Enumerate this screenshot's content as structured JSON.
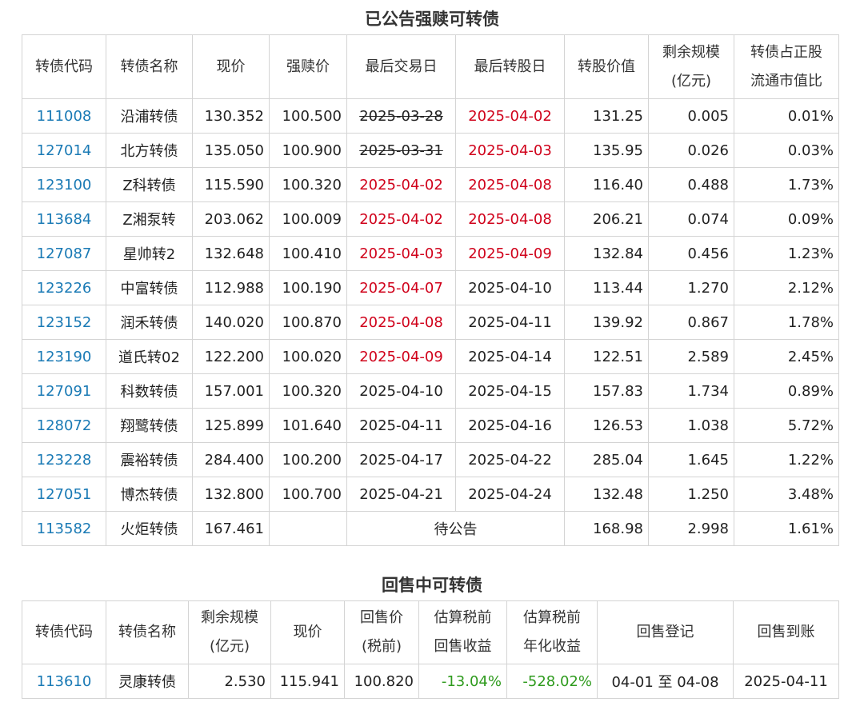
{
  "table1": {
    "title": "已公告强赎可转债",
    "headers": [
      "转债代码",
      "转债名称",
      "现价",
      "强赎价",
      "最后交易日",
      "最后转股日",
      "转股价值",
      "剩余规模\n(亿元)",
      "转债占正股\n流通市值比"
    ],
    "pending_label": "待公告",
    "rows": [
      {
        "code": "111008",
        "name": "沿浦转债",
        "price": "130.352",
        "redeem": "100.500",
        "last_trade": "2025-03-28",
        "last_trade_style": "strike",
        "last_conv": "2025-04-02",
        "last_conv_style": "red",
        "conv_value": "131.25",
        "remain": "0.005",
        "ratio": "0.01%"
      },
      {
        "code": "127014",
        "name": "北方转债",
        "price": "135.050",
        "redeem": "100.900",
        "last_trade": "2025-03-31",
        "last_trade_style": "strike",
        "last_conv": "2025-04-03",
        "last_conv_style": "red",
        "conv_value": "135.95",
        "remain": "0.026",
        "ratio": "0.03%"
      },
      {
        "code": "123100",
        "name": "Z科转债",
        "price": "115.590",
        "redeem": "100.320",
        "last_trade": "2025-04-02",
        "last_trade_style": "red",
        "last_conv": "2025-04-08",
        "last_conv_style": "red",
        "conv_value": "116.40",
        "remain": "0.488",
        "ratio": "1.73%"
      },
      {
        "code": "113684",
        "name": "Z湘泵转",
        "price": "203.062",
        "redeem": "100.009",
        "last_trade": "2025-04-02",
        "last_trade_style": "red",
        "last_conv": "2025-04-08",
        "last_conv_style": "red",
        "conv_value": "206.21",
        "remain": "0.074",
        "ratio": "0.09%"
      },
      {
        "code": "127087",
        "name": "星帅转2",
        "price": "132.648",
        "redeem": "100.410",
        "last_trade": "2025-04-03",
        "last_trade_style": "red",
        "last_conv": "2025-04-09",
        "last_conv_style": "red",
        "conv_value": "132.84",
        "remain": "0.456",
        "ratio": "1.23%"
      },
      {
        "code": "123226",
        "name": "中富转债",
        "price": "112.988",
        "redeem": "100.190",
        "last_trade": "2025-04-07",
        "last_trade_style": "red",
        "last_conv": "2025-04-10",
        "last_conv_style": "",
        "conv_value": "113.44",
        "remain": "1.270",
        "ratio": "2.12%"
      },
      {
        "code": "123152",
        "name": "润禾转债",
        "price": "140.020",
        "redeem": "100.870",
        "last_trade": "2025-04-08",
        "last_trade_style": "red",
        "last_conv": "2025-04-11",
        "last_conv_style": "",
        "conv_value": "139.92",
        "remain": "0.867",
        "ratio": "1.78%"
      },
      {
        "code": "123190",
        "name": "道氏转02",
        "price": "122.200",
        "redeem": "100.020",
        "last_trade": "2025-04-09",
        "last_trade_style": "red",
        "last_conv": "2025-04-14",
        "last_conv_style": "",
        "conv_value": "122.51",
        "remain": "2.589",
        "ratio": "2.45%"
      },
      {
        "code": "127091",
        "name": "科数转债",
        "price": "157.001",
        "redeem": "100.320",
        "last_trade": "2025-04-10",
        "last_trade_style": "",
        "last_conv": "2025-04-15",
        "last_conv_style": "",
        "conv_value": "157.83",
        "remain": "1.734",
        "ratio": "0.89%"
      },
      {
        "code": "128072",
        "name": "翔鹭转债",
        "price": "125.899",
        "redeem": "101.640",
        "last_trade": "2025-04-11",
        "last_trade_style": "",
        "last_conv": "2025-04-16",
        "last_conv_style": "",
        "conv_value": "126.53",
        "remain": "1.038",
        "ratio": "5.72%"
      },
      {
        "code": "123228",
        "name": "震裕转债",
        "price": "284.400",
        "redeem": "100.200",
        "last_trade": "2025-04-17",
        "last_trade_style": "",
        "last_conv": "2025-04-22",
        "last_conv_style": "",
        "conv_value": "285.04",
        "remain": "1.645",
        "ratio": "1.22%"
      },
      {
        "code": "127051",
        "name": "博杰转债",
        "price": "132.800",
        "redeem": "100.700",
        "last_trade": "2025-04-21",
        "last_trade_style": "",
        "last_conv": "2025-04-24",
        "last_conv_style": "",
        "conv_value": "132.48",
        "remain": "1.250",
        "ratio": "3.48%"
      },
      {
        "code": "113582",
        "name": "火炬转债",
        "price": "167.461",
        "pending": true,
        "conv_value": "168.98",
        "remain": "2.998",
        "ratio": "1.61%"
      }
    ]
  },
  "table2": {
    "title": "回售中可转债",
    "headers": [
      "转债代码",
      "转债名称",
      "剩余规模\n(亿元)",
      "现价",
      "回售价\n(税前)",
      "估算税前\n回售收益",
      "估算税前\n年化收益",
      "回售登记",
      "回售到账"
    ],
    "rows": [
      {
        "code": "113610",
        "name": "灵康转债",
        "remain": "2.530",
        "price": "115.941",
        "put_price": "100.820",
        "est_return": "-13.04%",
        "est_annual": "-528.02%",
        "register": "04-01 至 04-08",
        "arrival": "2025-04-11"
      }
    ]
  },
  "colors": {
    "link": "#1a7ab5",
    "red": "#d0021b",
    "green": "#2f9b1e",
    "border": "#d4d4d4"
  }
}
